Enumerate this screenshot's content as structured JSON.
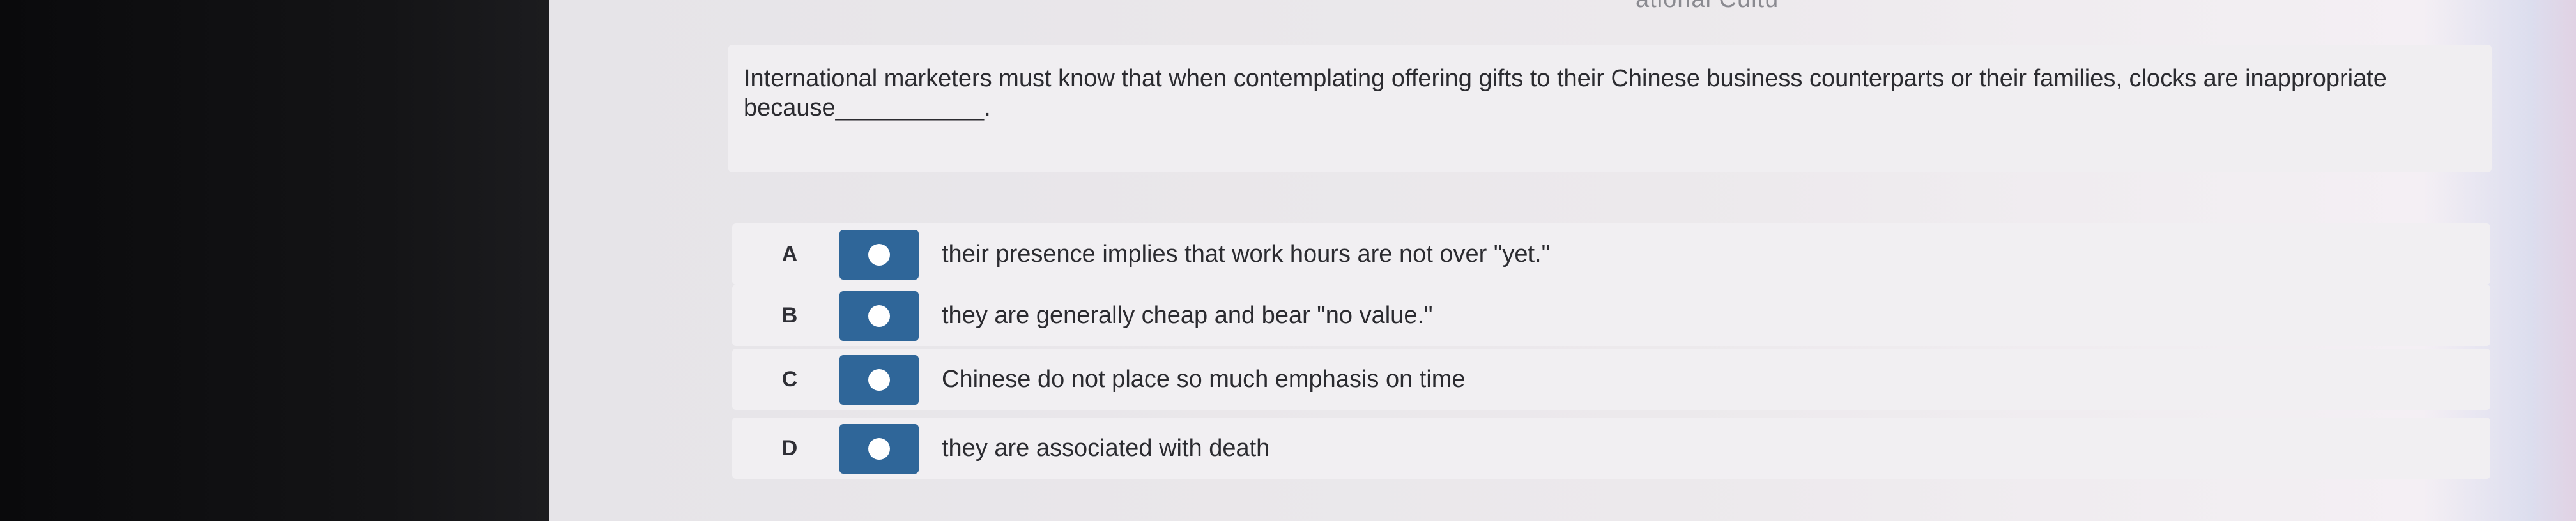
{
  "header": {
    "partial_title": "ational Cultu"
  },
  "question": {
    "text": "International marketers must know that when contemplating offering gifts to their Chinese business counterparts or their families, clocks are inappropriate because___________."
  },
  "options": [
    {
      "letter": "A",
      "text": "their presence implies that work hours are not over \"yet.\""
    },
    {
      "letter": "B",
      "text": "they are generally cheap and bear \"no value.\""
    },
    {
      "letter": "C",
      "text": "Chinese do not place so much emphasis on time"
    },
    {
      "letter": "D",
      "text": "they are associated with death"
    }
  ],
  "colors": {
    "radio_button": "#2f6699",
    "radio_dot": "#ffffff",
    "text": "#2b2b30"
  }
}
